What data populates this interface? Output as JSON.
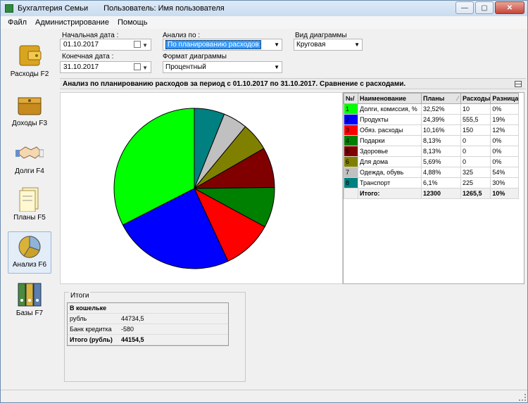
{
  "window": {
    "app_title": "Бухгалтерия Семьи",
    "user_label": "Пользователь: Имя пользователя",
    "minimize": "—",
    "maximize": "▢",
    "close": "✕"
  },
  "menu": [
    "Файл",
    "Администрирование",
    "Помощь"
  ],
  "sidebar": [
    {
      "label": "Расходы F2",
      "icon": "wallet-expense-icon"
    },
    {
      "label": "Доходы F3",
      "icon": "wallet-income-icon"
    },
    {
      "label": "Долги F4",
      "icon": "handshake-icon"
    },
    {
      "label": "Планы F5",
      "icon": "folder-plans-icon"
    },
    {
      "label": "Анализ F6",
      "icon": "pie-analysis-icon"
    },
    {
      "label": "Базы F7",
      "icon": "binders-icon"
    }
  ],
  "filters": {
    "start_date_label": "Начальная дата :",
    "start_date": "01.10.2017",
    "end_date_label": "Конечная дата :",
    "end_date": "31.10.2017",
    "analysis_label": "Анализ по :",
    "analysis_value": "По планированию расходов",
    "format_label": "Формат диаграммы",
    "format_value": "Процентный",
    "chart_type_label": "Вид диаграммы",
    "chart_type_value": "Круговая"
  },
  "report_title": "Анализ по планированию расходов за период с 01.10.2017 по 31.10.2017. Сравнение с расходами.",
  "table": {
    "headers": [
      "№/",
      "Наименование",
      "Планы",
      "Расходы",
      "Разница"
    ],
    "rows": [
      {
        "num": "1",
        "name": "Долги, комиссия, %",
        "plan": "32,52%",
        "exp": "10",
        "diff": "0%",
        "color": "#00ff00"
      },
      {
        "num": "2",
        "name": "Продукты",
        "plan": "24,39%",
        "exp": "555,5",
        "diff": "19%",
        "color": "#0000ff"
      },
      {
        "num": "3",
        "name": "Обяз. расходы",
        "plan": "10,16%",
        "exp": "150",
        "diff": "12%",
        "color": "#ff0000"
      },
      {
        "num": "4",
        "name": "Подарки",
        "plan": "8,13%",
        "exp": "0",
        "diff": "0%",
        "color": "#008000"
      },
      {
        "num": "5",
        "name": "Здоровье",
        "plan": "8,13%",
        "exp": "0",
        "diff": "0%",
        "color": "#800000"
      },
      {
        "num": "6",
        "name": "Для дома",
        "plan": "5,69%",
        "exp": "0",
        "diff": "0%",
        "color": "#808000"
      },
      {
        "num": "7",
        "name": "Одежда, обувь",
        "plan": "4,88%",
        "exp": "325",
        "diff": "54%",
        "color": "#c0c0c0"
      },
      {
        "num": "8",
        "name": "Транспорт",
        "plan": "6,1%",
        "exp": "225",
        "diff": "30%",
        "color": "#008080"
      }
    ],
    "total": {
      "name": "Итого:",
      "plan": "12300",
      "exp": "1265,5",
      "diff": "10%"
    }
  },
  "chart_data": {
    "type": "pie",
    "categories": [
      "Долги, комиссия, %",
      "Продукты",
      "Обяз. расходы",
      "Подарки",
      "Здоровье",
      "Для дома",
      "Одежда, обувь",
      "Транспорт"
    ],
    "values": [
      32.52,
      24.39,
      10.16,
      8.13,
      8.13,
      5.69,
      4.88,
      6.1
    ],
    "colors": [
      "#00ff00",
      "#0000ff",
      "#ff0000",
      "#008000",
      "#800000",
      "#808000",
      "#c0c0c0",
      "#008080"
    ]
  },
  "itogi": {
    "title": "Итоги",
    "header": "В кошельке",
    "rows": [
      {
        "k": "рубль",
        "v": "44734,5"
      },
      {
        "k": "Банк кредитка",
        "v": "-580"
      }
    ],
    "total_k": "Итого (рубль)",
    "total_v": "44154,5"
  }
}
